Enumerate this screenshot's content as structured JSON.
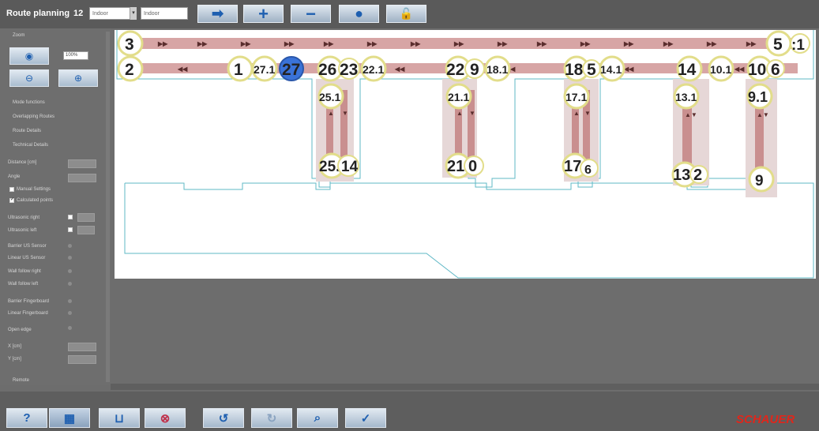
{
  "app": {
    "title": "Route planning",
    "version": "12"
  },
  "toolbar": {
    "select1": "Indoor",
    "select2": "Indoor",
    "buttons": [
      {
        "name": "arrow-right-icon",
        "glyph": "➡"
      },
      {
        "name": "plus-icon",
        "glyph": "+"
      },
      {
        "name": "minus-icon",
        "glyph": "−"
      },
      {
        "name": "record-icon",
        "glyph": "●"
      },
      {
        "name": "lock-icon",
        "glyph": "🔓"
      }
    ]
  },
  "sidebar": {
    "zoom_label": "Zoom",
    "zoom_value": "100%",
    "sections": [
      "Mode functions",
      "Overlapping Routes",
      "Route Details",
      "Technical Details"
    ],
    "fields": [
      {
        "label": "Distance [cm]",
        "value": ""
      },
      {
        "label": "Angle",
        "value": ""
      }
    ],
    "checks": [
      {
        "label": "Manual Settings",
        "checked": false
      },
      {
        "label": "Calculated points",
        "checked": true
      }
    ],
    "ultrasonic": [
      {
        "label": "Ultrasonic right"
      },
      {
        "label": "Ultrasonic left"
      }
    ],
    "options": [
      "Barrier US Sensor",
      "Linear US Sensor",
      "Wall follow right",
      "Wall follow left",
      "Barrier Fingerboard",
      "Linear Fingerboard",
      "Open edge"
    ],
    "coords": [
      {
        "label": "X [cm]",
        "value": ""
      },
      {
        "label": "Y [cm]",
        "value": ""
      }
    ],
    "footer": "Remote"
  },
  "map": {
    "nodes_top": [
      "3",
      "5",
      ":1"
    ],
    "nodes_mid": [
      "2",
      "1",
      "27.1",
      "27",
      "26",
      "23",
      "22.1",
      "22",
      "9",
      "18.1",
      "18",
      "5",
      "14.1",
      "14",
      "10.1",
      "10",
      "6"
    ],
    "nodes_branch_top": [
      "25.1",
      "21.1",
      "17.1",
      "13.1",
      "9.1"
    ],
    "nodes_branch_bottom": [
      "25.",
      "14",
      "21",
      "0",
      "17",
      "6",
      "13",
      "2",
      "9"
    ]
  },
  "bottom": {
    "buttons": [
      {
        "name": "help-icon",
        "glyph": "?"
      },
      {
        "name": "tools-icon",
        "glyph": "▦"
      },
      {
        "name": "tray-icon",
        "glyph": "⊔"
      },
      {
        "name": "cancel-icon",
        "glyph": "⊗"
      },
      {
        "name": "undo-icon",
        "glyph": "↺"
      },
      {
        "name": "redo-icon",
        "glyph": "↻"
      },
      {
        "name": "search-route-icon",
        "glyph": "⌕"
      },
      {
        "name": "confirm-icon",
        "glyph": "✓"
      }
    ],
    "brand": "SCHAUER"
  },
  "colors": {
    "route": "#d7a5a5",
    "route_dark": "#b57e7e",
    "node_fill": "#ffffff",
    "node_ring": "#e2dd8a",
    "selected": "#3a73d8",
    "outline": "#5fb8c6"
  }
}
